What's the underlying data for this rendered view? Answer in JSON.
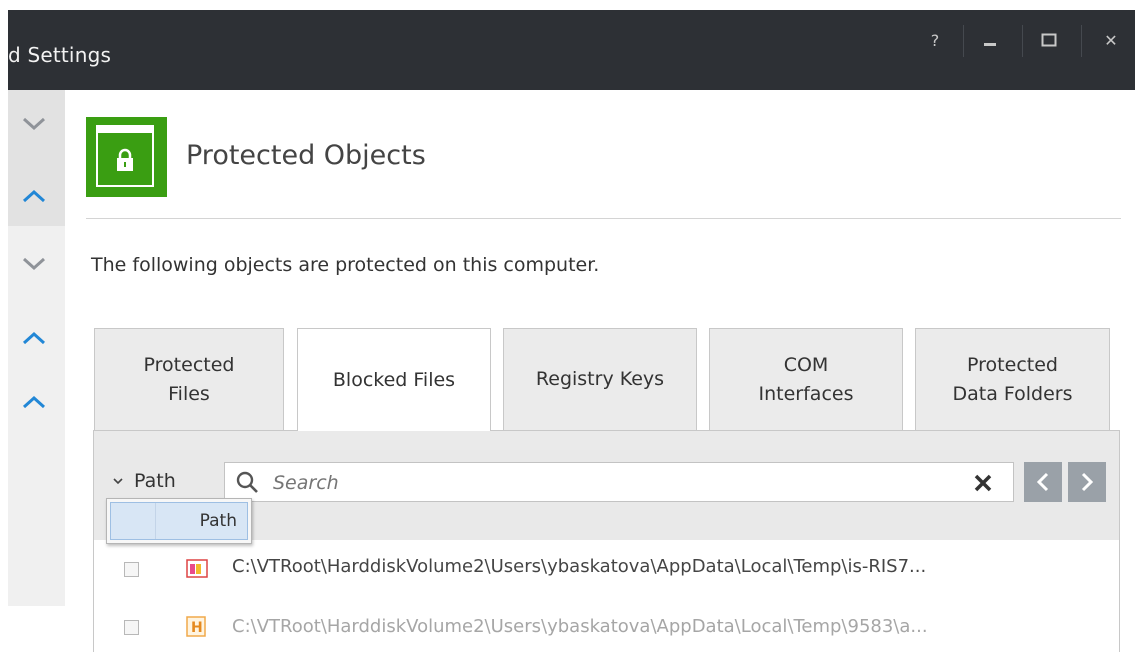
{
  "window": {
    "title": "d Settings",
    "help_label": "?",
    "min_label": "_",
    "close_label": "✕"
  },
  "header": {
    "title": "Protected Objects",
    "icon": "lock-icon",
    "accent": "#3a9e12"
  },
  "description": "The following objects are protected on this computer.",
  "tabs": [
    {
      "label": "Protected\nFiles"
    },
    {
      "label": "Blocked Files"
    },
    {
      "label": "Registry Keys"
    },
    {
      "label": "COM\nInterfaces"
    },
    {
      "label": "Protected\nData Folders"
    }
  ],
  "active_tab": "Blocked Files",
  "filter": {
    "column_label": "Path",
    "search_placeholder": "Search"
  },
  "dropdown": {
    "options": [
      "Path"
    ]
  },
  "rows": [
    {
      "path": "C:\\VTRoot\\HarddiskVolume2\\Users\\ybaskatova\\AppData\\Local\\Temp\\is-RIS7..."
    },
    {
      "path": "C:\\VTRoot\\HarddiskVolume2\\Users\\ybaskatova\\AppData\\Local\\Temp\\9583\\a..."
    }
  ],
  "sidebar": {
    "items": [
      "chevron-down-icon",
      "chevron-up-icon",
      "chevron-down-icon",
      "chevron-up-icon",
      "chevron-up-icon"
    ]
  }
}
